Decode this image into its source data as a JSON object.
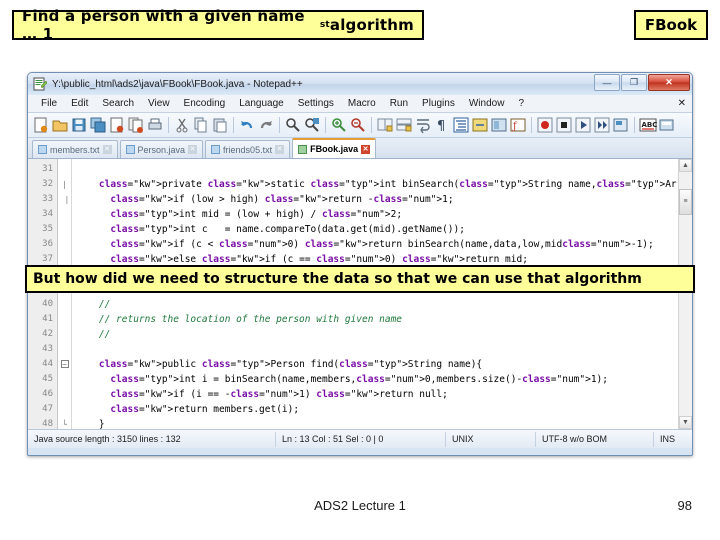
{
  "slide": {
    "title_callout": "Find a person with a given name … 1",
    "title_callout_sup": "st",
    "title_callout_tail": " algorithm",
    "fbook_callout": "FBook",
    "mid_callout": "But how did we need to structure the data so that we can use that algorithm",
    "footer_center": "ADS2 Lecture 1",
    "footer_page": "98",
    "accent_yellow": "#ffff99",
    "accent_border": "#000000"
  },
  "npp": {
    "title": "Y:\\public_html\\ads2\\java\\FBook\\FBook.java - Notepad++",
    "window_buttons": {
      "minimize": "—",
      "maximize": "❐",
      "close": "✕"
    },
    "menu": [
      "File",
      "Edit",
      "Search",
      "View",
      "Encoding",
      "Language",
      "Settings",
      "Macro",
      "Run",
      "Plugins",
      "Window",
      "?"
    ],
    "menu_right": "✕",
    "toolbar_icons": [
      "new-file-icon",
      "open-file-icon",
      "save-icon",
      "save-all-icon",
      "close-file-icon",
      "close-all-icon",
      "print-icon",
      "sep",
      "cut-icon",
      "copy-icon",
      "paste-icon",
      "sep",
      "undo-icon",
      "redo-icon",
      "sep",
      "find-icon",
      "replace-icon",
      "sep",
      "zoom-in-icon",
      "zoom-out-icon",
      "sep",
      "sync-scroll-v-icon",
      "sync-scroll-h-icon",
      "word-wrap-icon",
      "show-all-chars-icon",
      "indent-guide-icon",
      "ui-goto-icon",
      "doc-map-icon",
      "function-list-icon",
      "sep",
      "record-macro-icon",
      "stop-macro-icon",
      "play-macro-icon",
      "fast-play-macro-icon",
      "save-macro-icon",
      "sep",
      "spellcheck-icon",
      "run-icon"
    ],
    "tabs": [
      {
        "label": "members.txt",
        "active": false
      },
      {
        "label": "Person.java",
        "active": false
      },
      {
        "label": "friends05.txt",
        "active": false
      },
      {
        "label": "FBook.java",
        "active": true
      }
    ],
    "editor": {
      "top_block": [
        {
          "num": "31",
          "fold": "",
          "code": ""
        },
        {
          "num": "32",
          "fold": "|",
          "code": "    private static int binSearch(String name,ArrayList<Person> data,int low,int high){"
        },
        {
          "num": "33",
          "fold": "",
          "code": "      if (low > high) return -1;"
        },
        {
          "num": "34",
          "fold": "",
          "code": "      int mid = (low + high) / 2;"
        },
        {
          "num": "35",
          "fold": "",
          "code": "      int c   = name.compareTo(data.get(mid).getName());"
        },
        {
          "num": "36",
          "fold": "",
          "code": "      if (c < 0) return binSearch(name,data,low,mid-1);"
        },
        {
          "num": "37",
          "fold": "",
          "code": "      else if (c == 0) return mid;"
        }
      ],
      "bottom_block": [
        {
          "num": "40",
          "fold": "",
          "code": "    //"
        },
        {
          "num": "41",
          "fold": "",
          "code": "    // returns the location of the person with given name"
        },
        {
          "num": "42",
          "fold": "",
          "code": "    //"
        },
        {
          "num": "43",
          "fold": "",
          "code": ""
        },
        {
          "num": "44",
          "fold": "box",
          "code": "    public Person find(String name){"
        },
        {
          "num": "45",
          "fold": "",
          "code": "      int i = binSearch(name,members,0,members.size()-1);"
        },
        {
          "num": "46",
          "fold": "",
          "code": "      if (i == -1) return null;"
        },
        {
          "num": "47",
          "fold": "",
          "code": "      return members.get(i);"
        },
        {
          "num": "48",
          "fold": "end",
          "code": "    }"
        }
      ],
      "scrollbar": {
        "up_arrow": "▲",
        "down_arrow": "▼",
        "thumb_grip": "≡"
      }
    },
    "status": {
      "doc_info": "Java source length : 3150   lines : 132",
      "caret": "Ln : 13   Col : 51   Sel : 0 | 0",
      "eol": "UNIX",
      "encoding": "UTF-8 w/o BOM",
      "insert_mode": "INS"
    }
  }
}
